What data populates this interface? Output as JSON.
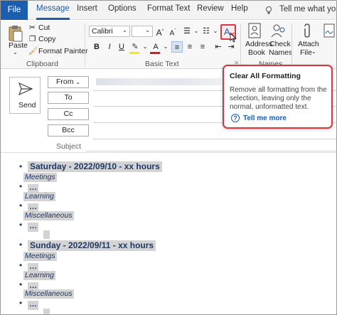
{
  "tabs": [
    "File",
    "Message",
    "Insert",
    "Options",
    "Format Text",
    "Review",
    "Help"
  ],
  "tell_me": "Tell me what you",
  "clipboard": {
    "paste": "Paste",
    "cut": "Cut",
    "copy": "Copy",
    "format_painter": "Format Painter",
    "group_label": "Clipboard"
  },
  "basic_text": {
    "font_name": "Calibri",
    "font_size": "",
    "bold": "B",
    "italic": "I",
    "underline": "U",
    "group_label": "Basic Text"
  },
  "names": {
    "address_book": [
      "Address",
      "Book"
    ],
    "check_names": [
      "Check",
      "Names"
    ],
    "group_label": "Names"
  },
  "attach": [
    "Attach",
    "File"
  ],
  "tooltip": {
    "title": "Clear All Formatting",
    "desc": "Remove all formatting from the selection, leaving only the normal, unformatted text.",
    "more": "Tell me more"
  },
  "header": {
    "send": "Send",
    "from": "From",
    "to": "To",
    "cc": "Cc",
    "bcc": "Bcc",
    "subject": "Subject"
  },
  "body": {
    "day1": "Saturday - 2022/09/10 - xx hours",
    "day2": "Sunday - 2022/09/11 - xx hours",
    "meetings": "Meetings",
    "learning": "Learning",
    "misc": "Miscellaneous",
    "dots": "…"
  },
  "colors": {
    "accent": "#1b5eb0",
    "highlight": "#d3d3d3",
    "callout": "#d9363e",
    "body_text": "#1f3864"
  }
}
